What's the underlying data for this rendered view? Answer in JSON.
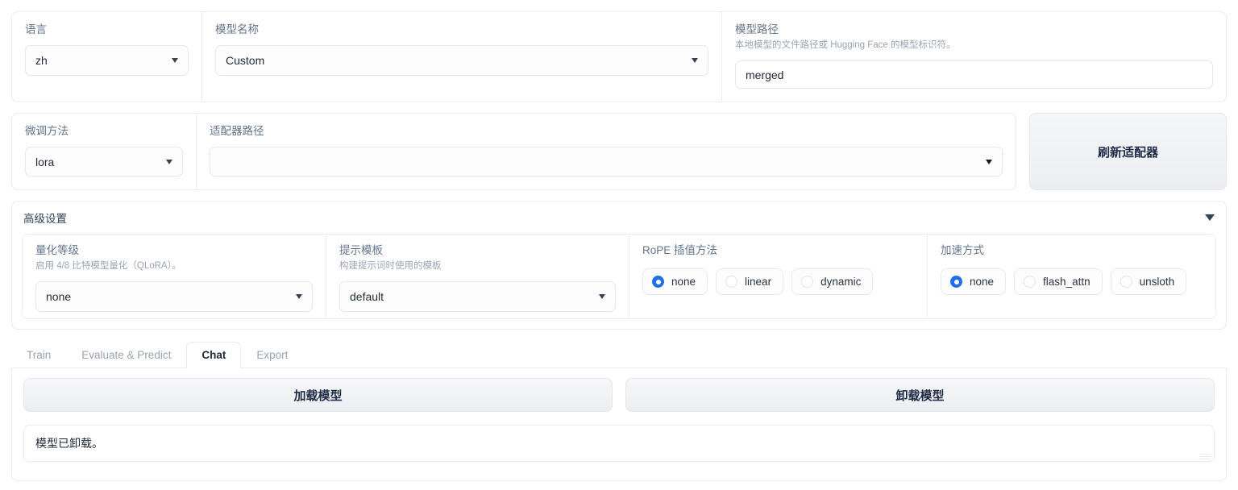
{
  "top_row": {
    "language": {
      "label": "语言",
      "value": "zh"
    },
    "model_name": {
      "label": "模型名称",
      "value": "Custom"
    },
    "model_path": {
      "label": "模型路径",
      "description": "本地模型的文件路径或 Hugging Face 的模型标识符。",
      "value": "merged"
    }
  },
  "second_row": {
    "finetune_method": {
      "label": "微调方法",
      "value": "lora"
    },
    "adapter_path": {
      "label": "适配器路径",
      "value": ""
    },
    "refresh_button": "刷新适配器"
  },
  "advanced": {
    "title": "高级设置",
    "quantization": {
      "label": "量化等级",
      "description": "启用 4/8 比特模型量化（QLoRA）。",
      "value": "none"
    },
    "template": {
      "label": "提示模板",
      "description": "构建提示词时使用的模板",
      "value": "default"
    },
    "rope": {
      "label": "RoPE 插值方法",
      "options": [
        "none",
        "linear",
        "dynamic"
      ],
      "selected": "none"
    },
    "booster": {
      "label": "加速方式",
      "options": [
        "none",
        "flash_attn",
        "unsloth"
      ],
      "selected": "none"
    }
  },
  "tabs": {
    "items": [
      "Train",
      "Evaluate & Predict",
      "Chat",
      "Export"
    ],
    "active": "Chat"
  },
  "chat": {
    "load_button": "加载模型",
    "unload_button": "卸载模型",
    "status": "模型已卸载。"
  },
  "colors": {
    "accent": "#1f6feb",
    "border": "#e9ebef",
    "text": "#1f2937",
    "muted": "#9aa4b2"
  }
}
